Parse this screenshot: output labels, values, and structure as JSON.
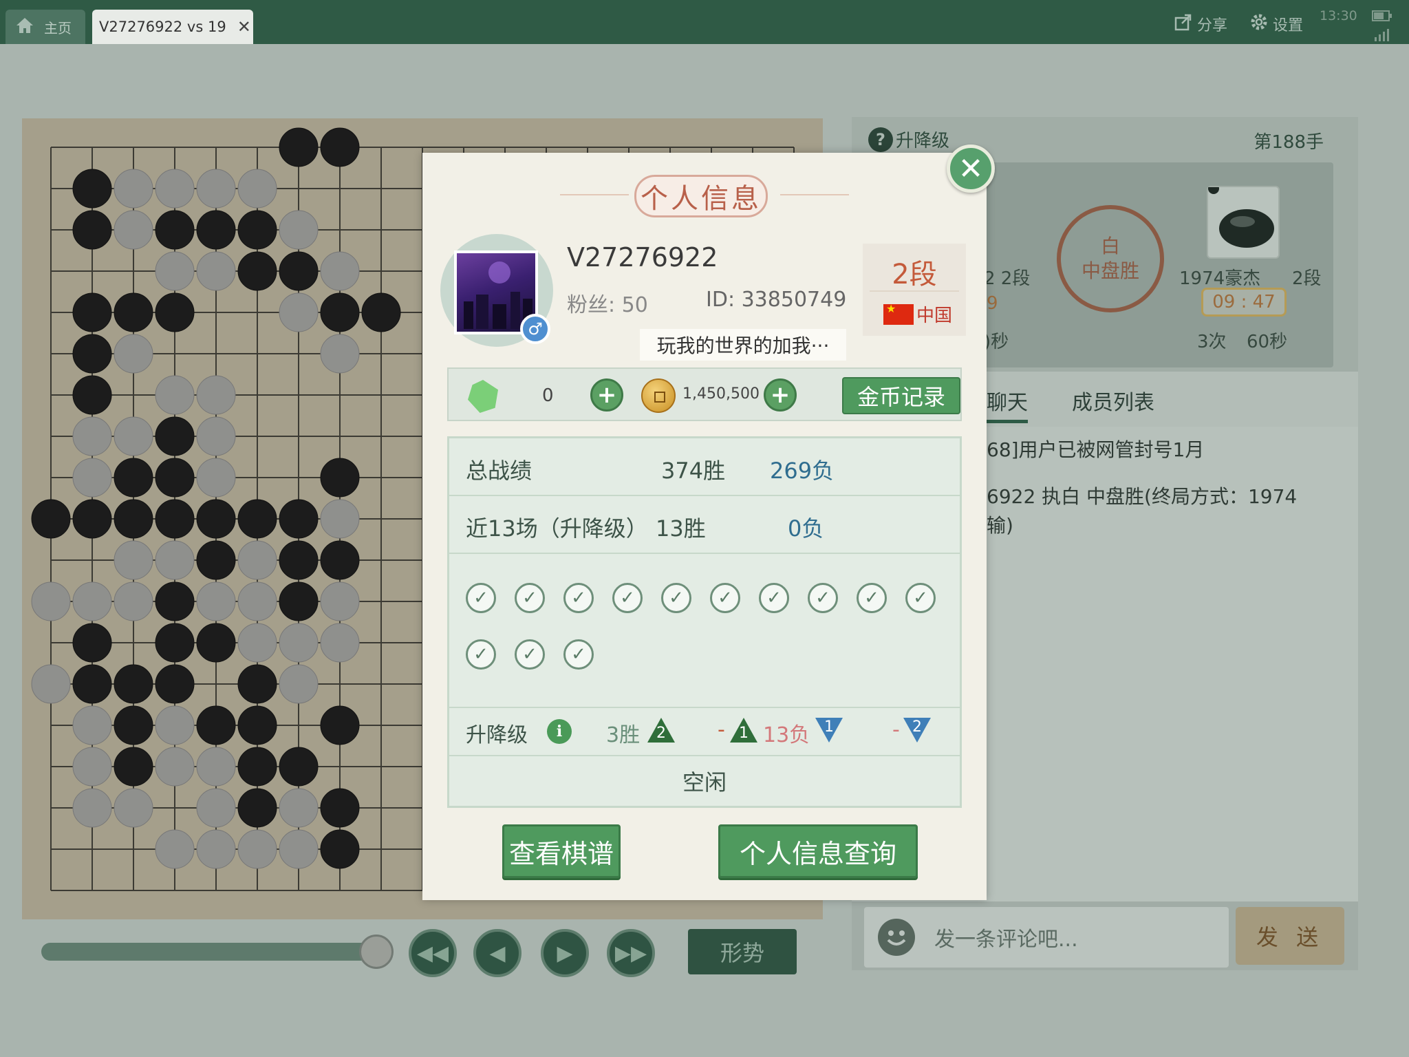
{
  "topbar": {
    "home_label": "主页",
    "game_tab_label": "V27276922 vs 19",
    "share_label": "分享",
    "settings_label": "设置",
    "time": "13:30"
  },
  "game_panel": {
    "mode_label": "升降级",
    "move_label": "第188手",
    "left_player_rank_partial": "2  2段",
    "left_timer_partial": "9",
    "left_byoyomi_partial": ")秒",
    "result_color": "白",
    "result_text": "中盘胜",
    "right_player_name": "1974豪杰",
    "right_player_rank": "2段",
    "right_timer": "09 : 47",
    "right_byoyomi_count": "3次",
    "right_byoyomi_secs": "60秒",
    "tab_chat": "聊天",
    "tab_members": "成员列表",
    "chat_line_1": "68]用户已被网管封号1月",
    "chat_line_2": "6922 执白 中盘胜(终局方式：1974",
    "chat_line_3": "输)",
    "comment_placeholder": "发一条评论吧...",
    "send_label": "发 送"
  },
  "controls": {
    "shape_label": "形势",
    "progress_fraction": 0.9
  },
  "modal": {
    "title": "个人信息",
    "username": "V27276922",
    "fans": "粉丝: 50",
    "user_id": "ID: 33850749",
    "rank": "2段",
    "country": "中国",
    "signature": "玩我的世界的加我···",
    "gems": "0",
    "coins": "1,450,500",
    "coin_record_label": "金币记录",
    "total_record_label": "总战绩",
    "total_wins": "374胜",
    "total_losses": "269负",
    "recent_label": "近13场（升降级）",
    "recent_wins": "13胜",
    "recent_losses": "0负",
    "recent_results": [
      "win",
      "win",
      "win",
      "win",
      "win",
      "win",
      "win",
      "win",
      "win",
      "win",
      "win",
      "win",
      "win"
    ],
    "promo_label": "升降级",
    "promo_wins": "3胜",
    "promo_up_num": "2",
    "promo_dash_1": "-",
    "promo_up_num_2": "1",
    "promo_losses": "13负",
    "promo_down_num": "1",
    "promo_dash_2": "-",
    "promo_down_num_2": "2",
    "status": "空闲",
    "view_games_label": "查看棋谱",
    "profile_query_label": "个人信息查询"
  },
  "colors": {
    "topbar": "#2f5a45",
    "accent_green": "#4f9a5e",
    "rank_red": "#c45a3a"
  }
}
